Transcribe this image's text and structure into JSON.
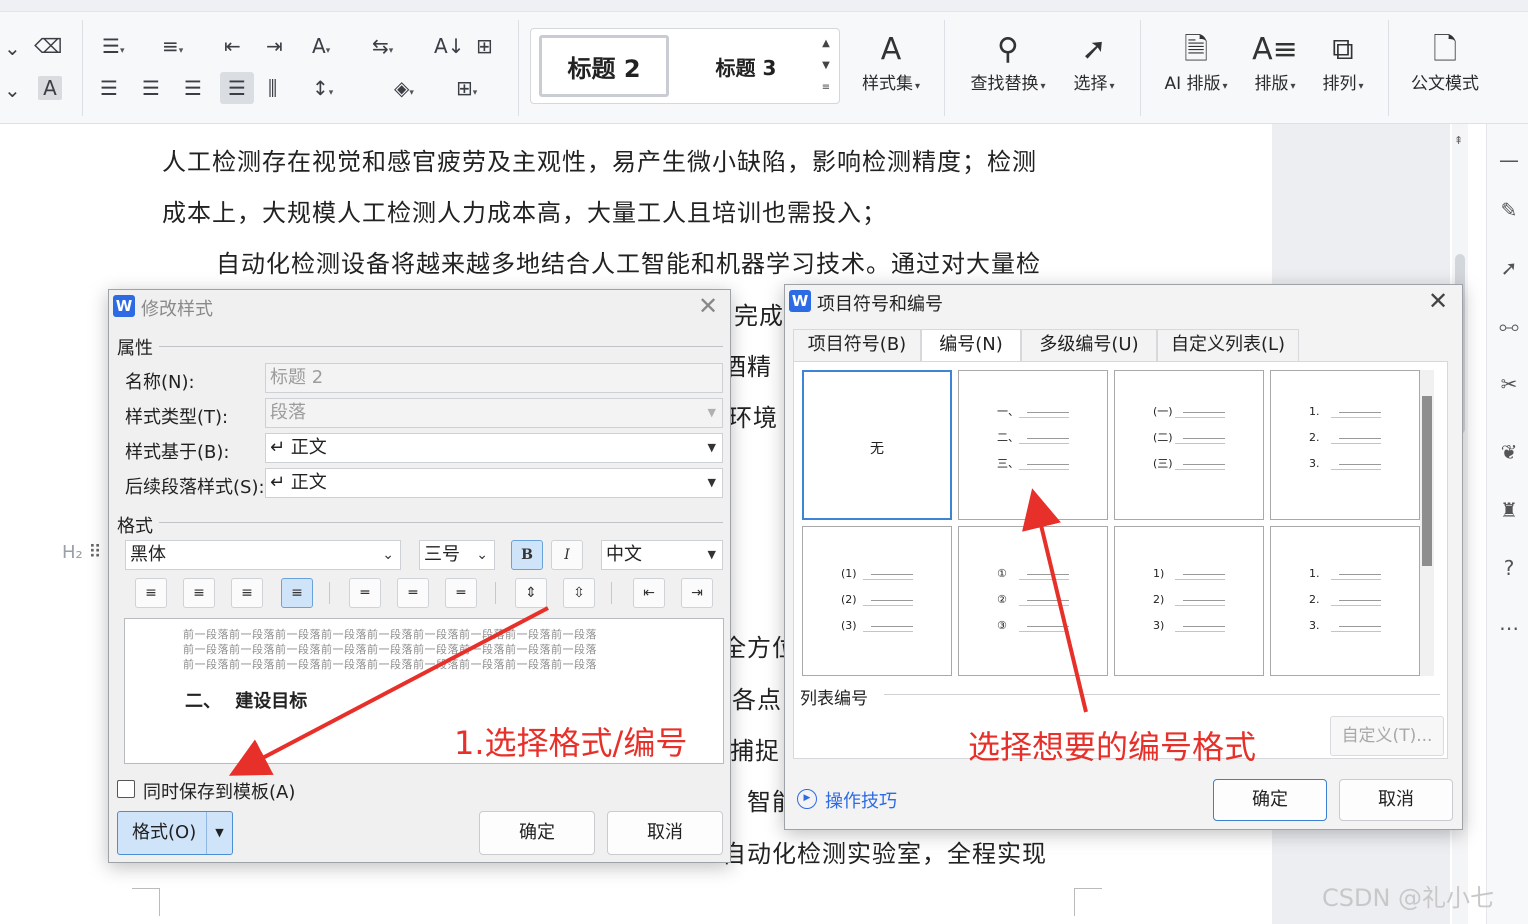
{
  "ribbon": {
    "style_gallery": {
      "h2": "标题 2",
      "h3": "标题 3"
    },
    "buttons": {
      "style_set": "样式集",
      "find_replace": "查找替换",
      "select": "选择",
      "ai_layout": "AI 排版",
      "layout": "排版",
      "arrange": "排列",
      "official_mode": "公文模式"
    }
  },
  "document": {
    "lines": [
      "人工检测存在视觉和感官疲劳及主观性，易产生微小缺陷，影响检测精度；检测",
      "成本上，大规模人工检测人力成本高，大量工人且培训也需投入；",
      "自动化检测设备将越来越多地结合人工智能和机器学习技术。通过对大量检"
    ],
    "fragments": [
      "完成",
      "酒精",
      "环境",
      "全方位",
      "各点",
      "捕捉",
      "、智能",
      "自动化检测实验室，全程实现"
    ],
    "heading_marker": "H₂"
  },
  "modify_style_dialog": {
    "title": "修改样式",
    "properties_label": "属性",
    "name_label": "名称(N):",
    "name_value": "标题 2",
    "style_type_label": "样式类型(T):",
    "style_type_value": "段落",
    "based_on_label": "样式基于(B):",
    "based_on_value": "↵ 正文",
    "next_style_label": "后续段落样式(S):",
    "next_style_value": "↵ 正文",
    "format_label": "格式",
    "font_value": "黑体",
    "size_value": "三号",
    "bold_label": "B",
    "italic_label": "I",
    "lang_value": "中文",
    "preview_filler": "前一段落前一段落前一段落前一段落前一段落前一段落前一段落前一段落前一段落",
    "preview_heading": "二、 建设目标",
    "save_template_label": "同时保存到模板(A)",
    "format_button": "格式(O)",
    "ok_button": "确定",
    "cancel_button": "取消"
  },
  "bullets_dialog": {
    "title": "项目符号和编号",
    "tabs": [
      "项目符号(B)",
      "编号(N)",
      "多级编号(U)",
      "自定义列表(L)"
    ],
    "active_tab": "编号(N)",
    "none_label": "无",
    "presets": [
      [
        "一、",
        "二、",
        "三、"
      ],
      [
        "(一)",
        "(二)",
        "(三)"
      ],
      [
        "1.",
        "2.",
        "3."
      ],
      [
        "(1)",
        "(2)",
        "(3)"
      ],
      [
        "①",
        "②",
        "③"
      ],
      [
        "1)",
        "2)",
        "3)"
      ],
      [
        "1.",
        "2.",
        "3."
      ]
    ],
    "list_numbering_label": "列表编号",
    "custom_button": "自定义(T)...",
    "tips_link": "操作技巧",
    "ok_button": "确定",
    "cancel_button": "取消"
  },
  "annotations": {
    "left": "1.选择格式/编号",
    "right": "选择想要的编号格式",
    "color": "#e8302a"
  },
  "watermark": "CSDN @礼小七"
}
